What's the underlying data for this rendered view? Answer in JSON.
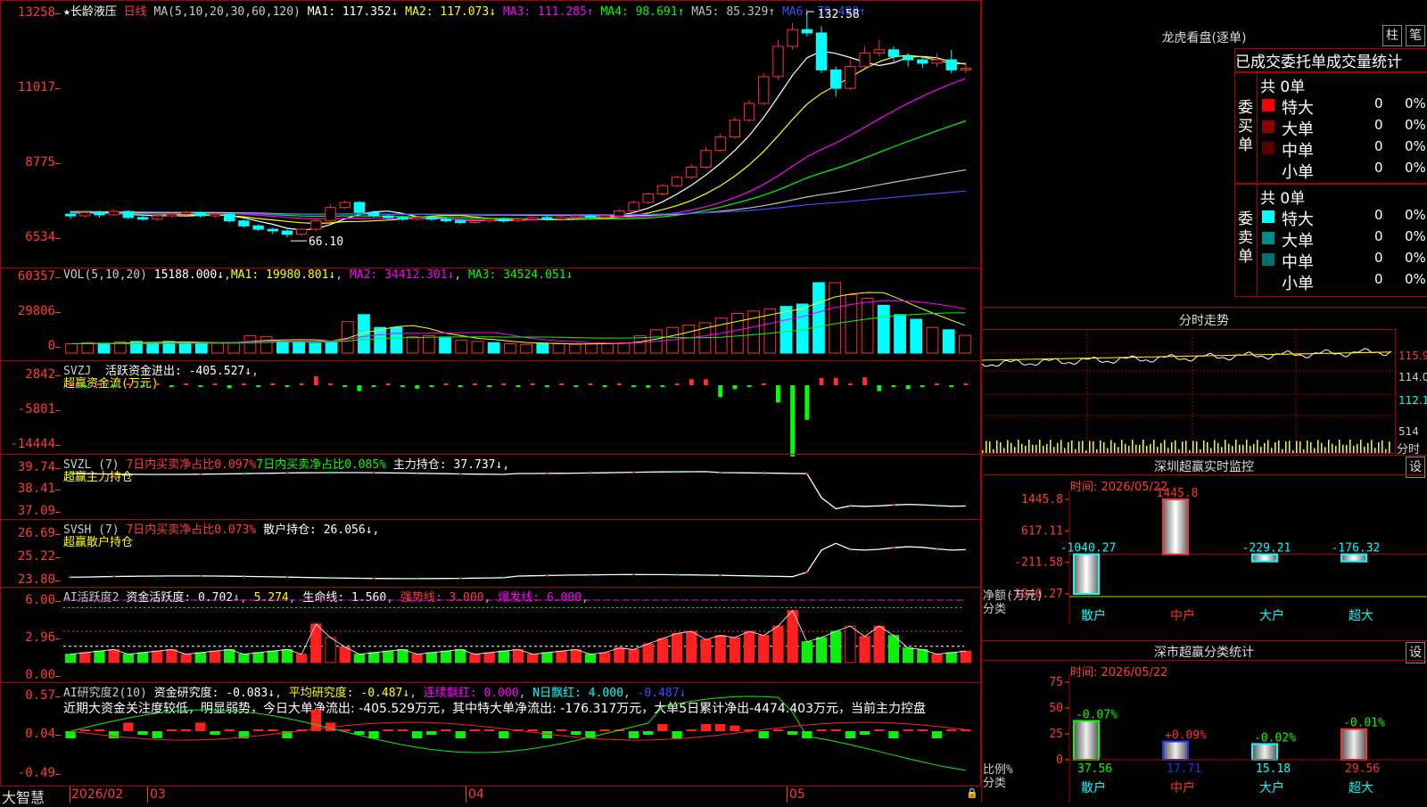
{
  "security": {
    "star": "★",
    "name": "长龄液压",
    "period": "日线"
  },
  "main_legend": {
    "ma_params": "MA(5,10,20,30,60,120)",
    "ma": [
      {
        "label": "MA1:",
        "value": "117.352↓",
        "color": "#ffffff"
      },
      {
        "label": "MA2:",
        "value": "117.073↓",
        "color": "#ffff00"
      },
      {
        "label": "MA3:",
        "value": "111.285↑",
        "color": "#ff00ff"
      },
      {
        "label": "MA4:",
        "value": "98.691↑",
        "color": "#00ff00"
      },
      {
        "label": "MA5:",
        "value": "85.329↑",
        "color": "#c0c0c0"
      },
      {
        "label": "MA6:",
        "value": "79.498↑",
        "color": "#3a4fff"
      }
    ]
  },
  "main_yticks": [
    "13258",
    "11017",
    "8775",
    "6534"
  ],
  "annotations": {
    "high": "132.58",
    "low": "66.10"
  },
  "vol_legend": {
    "name": "VOL(5,10,20)",
    "value": "15188.000↓",
    "ma1": "MA1: 19980.801↓",
    "ma2": "MA2: 34412.301↓",
    "ma3": "MA3: 34524.051↓"
  },
  "vol_yticks": [
    "60357",
    "29806",
    "0"
  ],
  "svzj_legend": {
    "name": "SVZJ",
    "label": "活跃资金进出: -405.527↓",
    "sub": "超赢资金流(万元)"
  },
  "svzj_yticks": [
    "2842",
    "-5801",
    "-14444"
  ],
  "svzl_legend": {
    "name": "SVZL (7)",
    "a": "7日内买卖净占比0.097%",
    "b": "7日内买卖净占比0.085%",
    "c": "主力持仓: 37.737↓,",
    "sub": "超赢主力持仓"
  },
  "svzl_yticks": [
    "39.74",
    "38.41",
    "37.09"
  ],
  "svsh_legend": {
    "name": "SVSH (7)",
    "a": "7日内买卖净占比0.073%",
    "c": "散户持仓: 26.056↓,",
    "sub": "超赢散户持仓"
  },
  "svsh_yticks": [
    "26.69",
    "25.22",
    "23.80"
  ],
  "ai1_legend": {
    "name": "AI活跃度2",
    "a": "资金活跃度: 0.702↓",
    "b": "5.274",
    "c": "生命线: 1.560",
    "d": "强势线: 3.000",
    "e": "爆发线: 6.000"
  },
  "ai1_yticks": [
    "6.00",
    "2.96",
    "0.00"
  ],
  "ai2_legend": {
    "name": "AI研究度2(10)",
    "a": "资金研究度: -0.083↓",
    "b": "平均研究度: -0.487↓",
    "c": "连续飘红: 0.000",
    "d": "N日飘红: 4.000",
    "e": "-0.487↓"
  },
  "ai2_text": "近期大资金关注度较低，明显弱势，今日大单净流出: -405.529万元，其中特大单净流出: -176.317万元，大单5日累计净出-4474.403万元，当前主力控盘",
  "ai2_yticks": [
    "0.57",
    "0.04",
    "-0.49"
  ],
  "footer": {
    "brand": "大智慧",
    "dates": [
      "2026/02",
      "03",
      "04",
      "05"
    ]
  },
  "right": {
    "lhb_title": "龙虎看盘(逐单)",
    "btn_bar": "柱",
    "btn_pen": "笔",
    "tabs": [
      "已成交",
      "委托单",
      "成交量统计"
    ],
    "buy": {
      "side": "委买单",
      "total": "共 0单",
      "rows": [
        {
          "label": "特大",
          "num": "0",
          "pct": "0%",
          "color": "#ff0000"
        },
        {
          "label": "大单",
          "num": "0",
          "pct": "0%",
          "color": "#8b0000"
        },
        {
          "label": "中单",
          "num": "0",
          "pct": "0%",
          "color": "#5a0000"
        },
        {
          "label": "小单",
          "num": "0",
          "pct": "0%",
          "color": ""
        }
      ]
    },
    "sell": {
      "side": "委卖单",
      "total": "共 0单",
      "rows": [
        {
          "label": "特大",
          "num": "0",
          "pct": "0%",
          "color": "#00ffff"
        },
        {
          "label": "大单",
          "num": "0",
          "pct": "0%",
          "color": "#008b8b"
        },
        {
          "label": "中单",
          "num": "0",
          "pct": "0%",
          "color": "#007070"
        },
        {
          "label": "小单",
          "num": "0",
          "pct": "0%",
          "color": ""
        }
      ]
    },
    "intraday_title": "分时走势",
    "intraday_yticks": [
      "115.9",
      "114.0",
      "112.1",
      "514"
    ],
    "intraday_unit": "分时",
    "sz_title": "深圳超赢实时监控",
    "sz_time": "时间: 2026/05/22",
    "btn_set": "设",
    "sz_yticks": [
      "1445.8",
      "617.11",
      "-211.58",
      "-1040.27"
    ],
    "sz_ylabel1": "净额(万元)",
    "sz_ylabel2": "分类",
    "sz_cats": [
      "散户",
      "中户",
      "大户",
      "超大"
    ],
    "sz_values": [
      -1040.27,
      1445.8,
      -229.21,
      -176.32
    ],
    "sz_value_labels": [
      "-1040.27",
      "1445.8",
      "-229.21",
      "-176.32"
    ],
    "ss_title": "深市超赢分类统计",
    "ss_time": "时间: 2026/05/22",
    "ss_yticks": [
      "75",
      "50",
      "25",
      "0"
    ],
    "ss_ylabel1": "比例%",
    "ss_ylabel2": "分类",
    "ss_values": [
      37.56,
      17.71,
      15.18,
      29.56
    ],
    "ss_top_labels": [
      "-0.07%",
      "+0.09%",
      "-0.02%",
      "-0.01%"
    ]
  },
  "chart_data": [
    {
      "type": "candlestick",
      "title": "长龄液压 日线",
      "ylim": [
        6534,
        13258
      ],
      "x_ticks": [
        "2026/02",
        "03",
        "04",
        "05"
      ],
      "note": "approximate daily bars read from chart (open,close,low,high) in price units x100 scale as labeled",
      "ohlc": [
        [
          7300,
          7250,
          7150,
          7400
        ],
        [
          7250,
          7350,
          7200,
          7420
        ],
        [
          7350,
          7280,
          7200,
          7400
        ],
        [
          7280,
          7380,
          7250,
          7450
        ],
        [
          7380,
          7200,
          7150,
          7420
        ],
        [
          7200,
          7150,
          7100,
          7300
        ],
        [
          7150,
          7250,
          7100,
          7300
        ],
        [
          7250,
          7300,
          7200,
          7350
        ],
        [
          7300,
          7350,
          7250,
          7400
        ],
        [
          7350,
          7250,
          7200,
          7380
        ],
        [
          7250,
          7300,
          7200,
          7350
        ],
        [
          7300,
          7100,
          7050,
          7350
        ],
        [
          7100,
          6950,
          6900,
          7150
        ],
        [
          6950,
          6850,
          6800,
          7000
        ],
        [
          6850,
          6800,
          6700,
          6900
        ],
        [
          6800,
          6700,
          6610,
          6850
        ],
        [
          6700,
          6850,
          6650,
          6900
        ],
        [
          6850,
          7100,
          6800,
          7150
        ],
        [
          7100,
          7500,
          7050,
          7600
        ],
        [
          7500,
          7650,
          7450,
          7700
        ],
        [
          7650,
          7350,
          7300,
          7700
        ],
        [
          7350,
          7250,
          7200,
          7400
        ],
        [
          7250,
          7200,
          7150,
          7300
        ],
        [
          7200,
          7150,
          7100,
          7250
        ],
        [
          7150,
          7200,
          7100,
          7250
        ],
        [
          7200,
          7150,
          7100,
          7250
        ],
        [
          7150,
          7100,
          7050,
          7200
        ],
        [
          7100,
          7050,
          7000,
          7150
        ],
        [
          7050,
          7100,
          7000,
          7150
        ],
        [
          7100,
          7150,
          7050,
          7200
        ],
        [
          7150,
          7100,
          7050,
          7200
        ],
        [
          7100,
          7150,
          7050,
          7200
        ],
        [
          7150,
          7200,
          7100,
          7250
        ],
        [
          7200,
          7150,
          7100,
          7250
        ],
        [
          7150,
          7200,
          7100,
          7250
        ],
        [
          7200,
          7250,
          7150,
          7300
        ],
        [
          7250,
          7200,
          7150,
          7300
        ],
        [
          7200,
          7250,
          7150,
          7300
        ],
        [
          7250,
          7400,
          7200,
          7450
        ],
        [
          7400,
          7650,
          7350,
          7700
        ],
        [
          7650,
          7900,
          7600,
          7950
        ],
        [
          7900,
          8150,
          7850,
          8200
        ],
        [
          8150,
          8400,
          8100,
          8450
        ],
        [
          8400,
          8700,
          8350,
          8800
        ],
        [
          8700,
          9200,
          8650,
          9300
        ],
        [
          9200,
          9600,
          9150,
          9700
        ],
        [
          9600,
          10100,
          9550,
          10200
        ],
        [
          10100,
          10600,
          10050,
          10700
        ],
        [
          10600,
          11400,
          10550,
          11500
        ],
        [
          11400,
          12300,
          11300,
          12500
        ],
        [
          12300,
          12800,
          12200,
          13000
        ],
        [
          12800,
          12700,
          12600,
          13258
        ],
        [
          12700,
          11600,
          11500,
          12900
        ],
        [
          11600,
          11050,
          10800,
          11700
        ],
        [
          11050,
          11700,
          11000,
          11900
        ],
        [
          11700,
          12100,
          11650,
          12300
        ],
        [
          12100,
          12200,
          12000,
          12500
        ],
        [
          12200,
          12000,
          11800,
          12300
        ],
        [
          12000,
          11900,
          11700,
          12100
        ],
        [
          11900,
          11800,
          11650,
          12000
        ],
        [
          11800,
          11900,
          11700,
          12100
        ],
        [
          11900,
          11600,
          11500,
          12200
        ],
        [
          11600,
          11650,
          11500,
          11800
        ]
      ]
    },
    {
      "type": "bar",
      "title": "VOL(5,10,20)",
      "ylim": [
        0,
        60357
      ],
      "values": [
        8000,
        9000,
        8500,
        9500,
        10000,
        9000,
        10000,
        9500,
        8000,
        8500,
        9000,
        15000,
        14000,
        10000,
        9500,
        8500,
        9000,
        27000,
        33000,
        22000,
        22000,
        14000,
        15000,
        13000,
        11000,
        10000,
        9000,
        8000,
        7500,
        8500,
        8000,
        7500,
        8000,
        8500,
        9000,
        15000,
        20000,
        22000,
        24000,
        26000,
        30000,
        34000,
        36000,
        38000,
        40000,
        42000,
        60357,
        60357,
        50000,
        47000,
        41000,
        33000,
        29000,
        22000,
        20000,
        15188
      ]
    },
    {
      "type": "bar",
      "title": "SVZJ 活跃资金进出",
      "ylim": [
        -14444,
        2842
      ],
      "last": -405.527
    },
    {
      "type": "line",
      "title": "SVZL 主力持仓",
      "ylim": [
        37.09,
        39.74
      ],
      "last": 37.737
    },
    {
      "type": "line",
      "title": "SVSH 散户持仓",
      "ylim": [
        23.8,
        26.69
      ],
      "last": 26.056
    },
    {
      "type": "bar",
      "title": "AI活跃度2",
      "ylim": [
        0,
        6.0
      ],
      "last": 0.702
    },
    {
      "type": "bar",
      "title": "AI研究度2(10)",
      "ylim": [
        -0.49,
        0.57
      ],
      "last": -0.083
    },
    {
      "type": "bar",
      "title": "深圳超赢实时监控",
      "categories": [
        "散户",
        "中户",
        "大户",
        "超大"
      ],
      "values": [
        -1040.27,
        1445.8,
        -229.21,
        -176.32
      ],
      "ylabel": "净额(万元)"
    },
    {
      "type": "bar",
      "title": "深市超赢分类统计",
      "categories": [
        "散户",
        "中户",
        "大户",
        "超大"
      ],
      "values": [
        37.56,
        17.71,
        15.18,
        29.56
      ],
      "ylabel": "比例%",
      "ylim": [
        0,
        75
      ]
    }
  ]
}
